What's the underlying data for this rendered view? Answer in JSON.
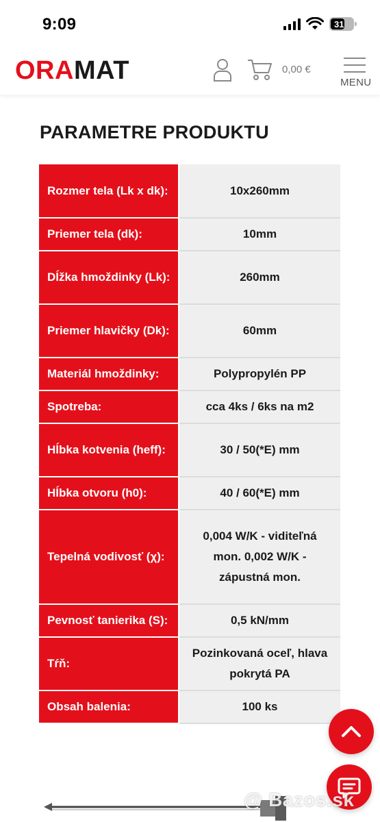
{
  "status_bar": {
    "time": "9:09",
    "battery_level": "31"
  },
  "header": {
    "logo_part1": "ORA",
    "logo_part2": "MAT",
    "cart_total": "0,00 €",
    "menu_label": "MENU"
  },
  "section": {
    "title": "PARAMETRE PRODUKTU"
  },
  "params": [
    {
      "key": "Rozmer tela (Lk x dk):",
      "value": "10x260mm"
    },
    {
      "key": "Priemer tela (dk):",
      "value": "10mm"
    },
    {
      "key": "Dĺžka hmoždinky (Lk):",
      "value": "260mm"
    },
    {
      "key": "Priemer hlavičky (Dk):",
      "value": "60mm"
    },
    {
      "key": "Materiál hmoždinky:",
      "value": "Polypropylén PP"
    },
    {
      "key": "Spotreba:",
      "value": "cca 4ks / 6ks na m2"
    },
    {
      "key": "Hĺbka kotvenia (heff):",
      "value": "30 / 50(*E) mm"
    },
    {
      "key": "Hĺbka otvoru (h0):",
      "value": "40 / 60(*E) mm"
    },
    {
      "key": "Tepelná vodivosť (χ):",
      "value": "0,004 W/K - viditeľná mon. 0,002 W/K - zápustná mon."
    },
    {
      "key": "Pevnosť tanierika (S):",
      "value": "0,5 kN/mm"
    },
    {
      "key": "Tŕň:",
      "value": "Pozinkovaná oceľ, hlava pokrytá PA"
    },
    {
      "key": "Obsah balenia:",
      "value": "100 ks"
    }
  ],
  "watermark": "@ Bazos.sk",
  "colors": {
    "brand_red": "#e3101b",
    "value_cell_bg": "#efefef"
  },
  "icons": {
    "user": "user-icon",
    "cart": "cart-icon",
    "menu": "hamburger-icon",
    "scroll_top": "chevron-up-icon",
    "chat": "chat-icon"
  }
}
